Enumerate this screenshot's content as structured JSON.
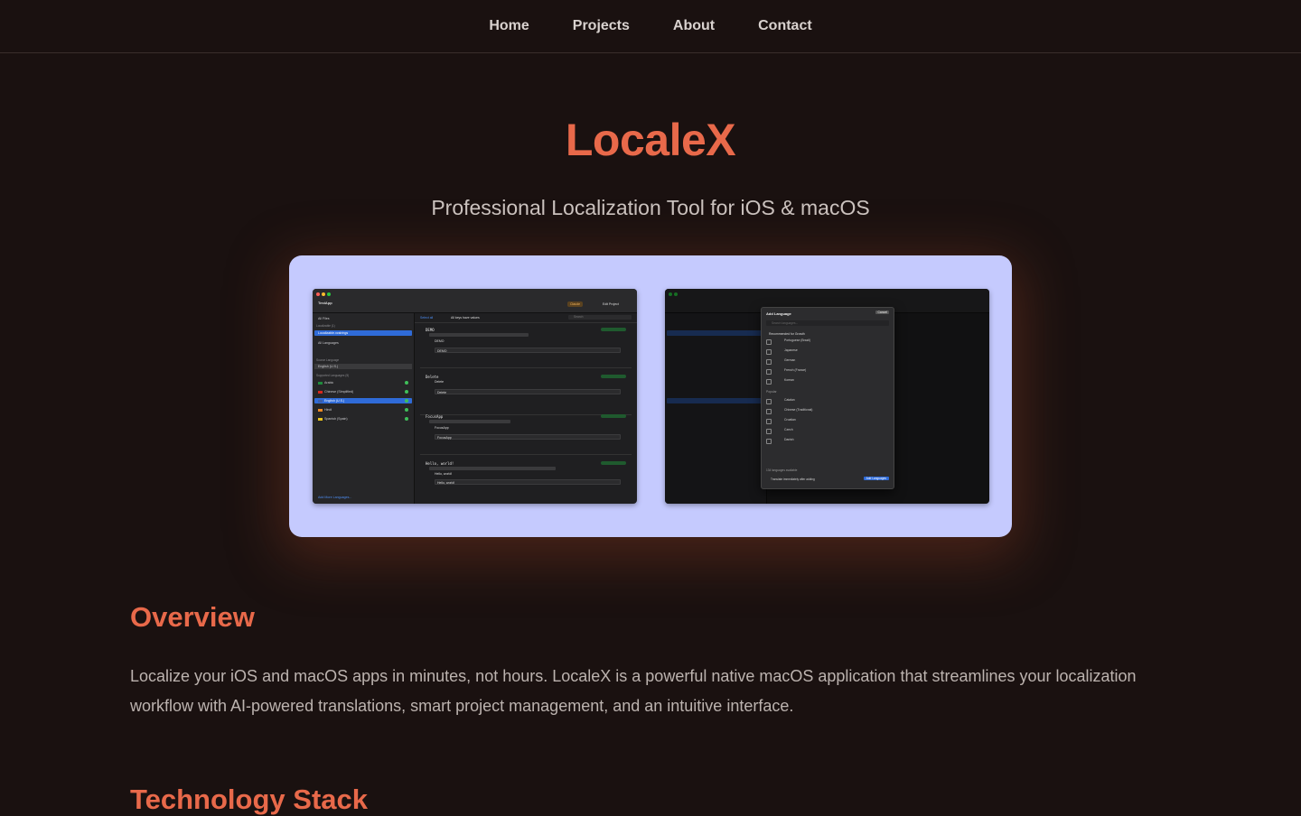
{
  "nav": {
    "items": [
      "Home",
      "Projects",
      "About",
      "Contact"
    ]
  },
  "hero": {
    "title": "LocaleX",
    "subtitle": "Professional Localization Tool for iOS & macOS"
  },
  "screenshots": {
    "left": {
      "app_title": "TestApp",
      "toolbar": {
        "cloud_label": "Claude",
        "edit_label": "Edit Project"
      },
      "sidebar": {
        "all_files": "All Files",
        "localizable_header": "Localizable (1)",
        "selected_file": "Localizable.xcstrings",
        "all_languages": "All Languages",
        "source_language_header": "Source Language",
        "source_language": "English (U.S.)",
        "supported_header": "Supported Languages (5)",
        "languages": [
          "Arabic",
          "Chinese (Simplified)",
          "English (U.S.)",
          "Hindi",
          "Spanish (Spain)"
        ],
        "add_more": "Add More Languages..."
      },
      "main": {
        "select_all": "Select all",
        "filter_label": "All keys have values",
        "search_placeholder": "Search",
        "entries": [
          {
            "key": "DEMO",
            "source": "DEMO",
            "target": "DEMO"
          },
          {
            "key": "Delete",
            "source": "Delete",
            "target": "Delete"
          },
          {
            "key": "FocusApp",
            "source": "FocusApp",
            "target": "FocusApp"
          },
          {
            "key": "Hello, world!",
            "source": "Hello, world!",
            "target": "Hello, world!"
          }
        ],
        "badge_label": "TRANSLATED"
      }
    },
    "right": {
      "dialog": {
        "title": "Add Language",
        "cancel_label": "Cancel",
        "search_placeholder": "Search languages...",
        "recommended_header": "Recommended for Growth",
        "recommended": [
          "Portuguese (Brazil)",
          "Japanese",
          "German",
          "French (France)",
          "Korean"
        ],
        "popular_header": "Popular",
        "popular": [
          "Catalan",
          "Chinese (Traditional)",
          "Croatian",
          "Czech",
          "Danish"
        ],
        "available_note": "134 languages available",
        "auto_translate_label": "Translate immediately after adding",
        "add_button_label": "Add Languages"
      }
    }
  },
  "overview": {
    "title": "Overview",
    "text": "Localize your iOS and macOS apps in minutes, not hours. LocaleX is a powerful native macOS application that streamlines your localization workflow with AI-powered translations, smart project management, and an intuitive interface."
  },
  "tech": {
    "title": "Technology Stack"
  },
  "colors": {
    "background": "#1a1110",
    "accent": "#e8694a",
    "showcase_bg": "#c5cafe"
  }
}
